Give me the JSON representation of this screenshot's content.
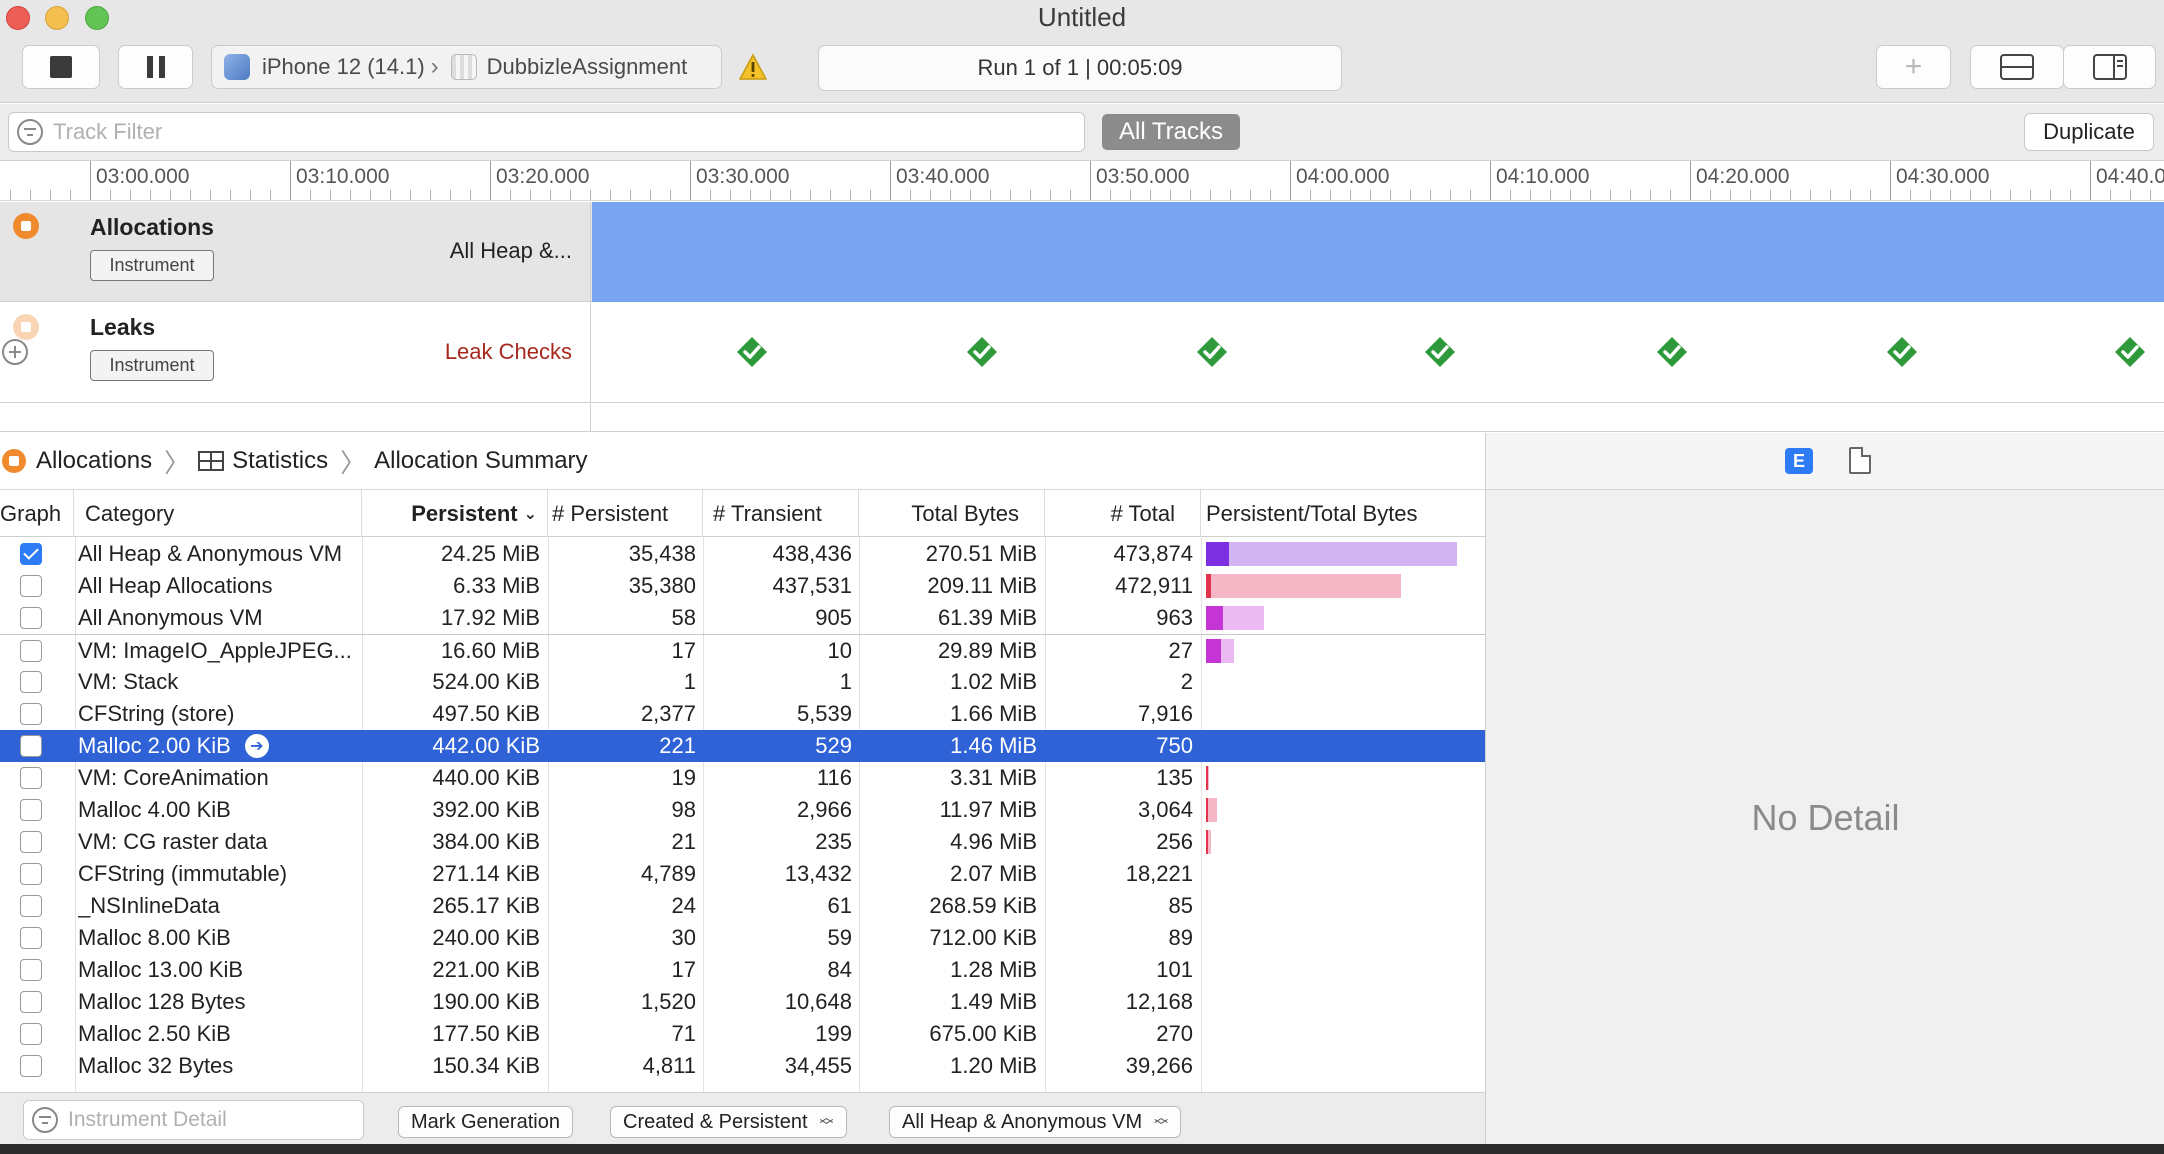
{
  "window": {
    "title": "Untitled"
  },
  "toolbar": {
    "device": "iPhone 12 (14.1)",
    "app": "DubbizleAssignment",
    "run_status": "Run 1 of 1  |  00:05:09"
  },
  "filterbar": {
    "track_filter_placeholder": "Track Filter",
    "all_tracks_label": "All Tracks",
    "duplicate_label": "Duplicate"
  },
  "ruler": {
    "ticks": [
      "03:00.000",
      "03:10.000",
      "03:20.000",
      "03:30.000",
      "03:40.000",
      "03:50.000",
      "04:00.000",
      "04:10.000",
      "04:20.000",
      "04:30.000",
      "04:40.0"
    ]
  },
  "tracks": {
    "allocations": {
      "name": "Allocations",
      "badge": "Instrument",
      "sub": "All Heap &..."
    },
    "leaks": {
      "name": "Leaks",
      "badge": "Instrument",
      "sub": "Leak Checks"
    }
  },
  "colors": {
    "allocations_graph": "#78a4f1",
    "leak_check": "#2f9a3c",
    "selection": "#2e62d6",
    "leak_label": "#a8281e"
  },
  "breadcrumb": {
    "items": [
      "Allocations",
      "Statistics",
      "Allocation Summary"
    ]
  },
  "table": {
    "columns": [
      "Graph",
      "Category",
      "Persistent",
      "# Persistent",
      "# Transient",
      "Total Bytes",
      "# Total",
      "Persistent/Total Bytes"
    ],
    "rows": [
      {
        "checked": true,
        "category": "All Heap & Anonymous VM",
        "persistent": "24.25 MiB",
        "n_persistent": "35,438",
        "n_transient": "438,436",
        "total_bytes": "270.51 MiB",
        "n_total": "473,874",
        "bar": {
          "persist": 0.086,
          "total": 0.95,
          "pc": "#7c2fe0",
          "tc": "#d2b4f2"
        }
      },
      {
        "checked": false,
        "category": "All Heap Allocations",
        "persistent": "6.33 MiB",
        "n_persistent": "35,380",
        "n_transient": "437,531",
        "total_bytes": "209.11 MiB",
        "n_total": "472,911",
        "bar": {
          "persist": 0.02,
          "total": 0.74,
          "pc": "#e0344e",
          "tc": "#f5b7c5"
        }
      },
      {
        "checked": false,
        "category": "All Anonymous VM",
        "persistent": "17.92 MiB",
        "n_persistent": "58",
        "n_transient": "905",
        "total_bytes": "61.39 MiB",
        "n_total": "963",
        "bar": {
          "persist": 0.063,
          "total": 0.22,
          "pc": "#c535d6",
          "tc": "#ecbaf2"
        }
      },
      {
        "checked": false,
        "category": "VM: ImageIO_AppleJPEG...",
        "persistent": "16.60 MiB",
        "n_persistent": "17",
        "n_transient": "10",
        "total_bytes": "29.89 MiB",
        "n_total": "27",
        "bar": {
          "persist": 0.058,
          "total": 0.105,
          "pc": "#c535d6",
          "tc": "#ecbaf2"
        }
      },
      {
        "checked": false,
        "category": "VM: Stack",
        "persistent": "524.00 KiB",
        "n_persistent": "1",
        "n_transient": "1",
        "total_bytes": "1.02 MiB",
        "n_total": "2"
      },
      {
        "checked": false,
        "category": "CFString (store)",
        "persistent": "497.50 KiB",
        "n_persistent": "2,377",
        "n_transient": "5,539",
        "total_bytes": "1.66 MiB",
        "n_total": "7,916"
      },
      {
        "checked": false,
        "category": "Malloc 2.00 KiB",
        "persistent": "442.00 KiB",
        "n_persistent": "221",
        "n_transient": "529",
        "total_bytes": "1.46 MiB",
        "n_total": "750",
        "selected": true
      },
      {
        "checked": false,
        "category": "VM: CoreAnimation",
        "persistent": "440.00 KiB",
        "n_persistent": "19",
        "n_transient": "116",
        "total_bytes": "3.31 MiB",
        "n_total": "135",
        "bar": {
          "persist": 0.001,
          "total": 0.012,
          "pc": "#e0344e",
          "tc": "#f5b7c5"
        }
      },
      {
        "checked": false,
        "category": "Malloc 4.00 KiB",
        "persistent": "392.00 KiB",
        "n_persistent": "98",
        "n_transient": "2,966",
        "total_bytes": "11.97 MiB",
        "n_total": "3,064",
        "bar": {
          "persist": 0.001,
          "total": 0.042,
          "pc": "#e0344e",
          "tc": "#f5b7c5"
        }
      },
      {
        "checked": false,
        "category": "VM: CG raster data",
        "persistent": "384.00 KiB",
        "n_persistent": "21",
        "n_transient": "235",
        "total_bytes": "4.96 MiB",
        "n_total": "256",
        "bar": {
          "persist": 0.001,
          "total": 0.018,
          "pc": "#e0344e",
          "tc": "#f5b7c5"
        }
      },
      {
        "checked": false,
        "category": "CFString (immutable)",
        "persistent": "271.14 KiB",
        "n_persistent": "4,789",
        "n_transient": "13,432",
        "total_bytes": "2.07 MiB",
        "n_total": "18,221"
      },
      {
        "checked": false,
        "category": "_NSInlineData",
        "persistent": "265.17 KiB",
        "n_persistent": "24",
        "n_transient": "61",
        "total_bytes": "268.59 KiB",
        "n_total": "85"
      },
      {
        "checked": false,
        "category": "Malloc 8.00 KiB",
        "persistent": "240.00 KiB",
        "n_persistent": "30",
        "n_transient": "59",
        "total_bytes": "712.00 KiB",
        "n_total": "89"
      },
      {
        "checked": false,
        "category": "Malloc 13.00 KiB",
        "persistent": "221.00 KiB",
        "n_persistent": "17",
        "n_transient": "84",
        "total_bytes": "1.28 MiB",
        "n_total": "101"
      },
      {
        "checked": false,
        "category": "Malloc 128 Bytes",
        "persistent": "190.00 KiB",
        "n_persistent": "1,520",
        "n_transient": "10,648",
        "total_bytes": "1.49 MiB",
        "n_total": "12,168"
      },
      {
        "checked": false,
        "category": "Malloc 2.50 KiB",
        "persistent": "177.50 KiB",
        "n_persistent": "71",
        "n_transient": "199",
        "total_bytes": "675.00 KiB",
        "n_total": "270"
      },
      {
        "checked": false,
        "category": "Malloc 32 Bytes",
        "persistent": "150.34 KiB",
        "n_persistent": "4,811",
        "n_transient": "34,455",
        "total_bytes": "1.20 MiB",
        "n_total": "39,266"
      }
    ]
  },
  "bottombar": {
    "instrument_detail_placeholder": "Instrument Detail",
    "mark_generation": "Mark Generation",
    "lifespan_select": "Created & Persistent",
    "allocation_type_select": "All Heap & Anonymous VM"
  },
  "detail": {
    "empty_text": "No Detail"
  }
}
